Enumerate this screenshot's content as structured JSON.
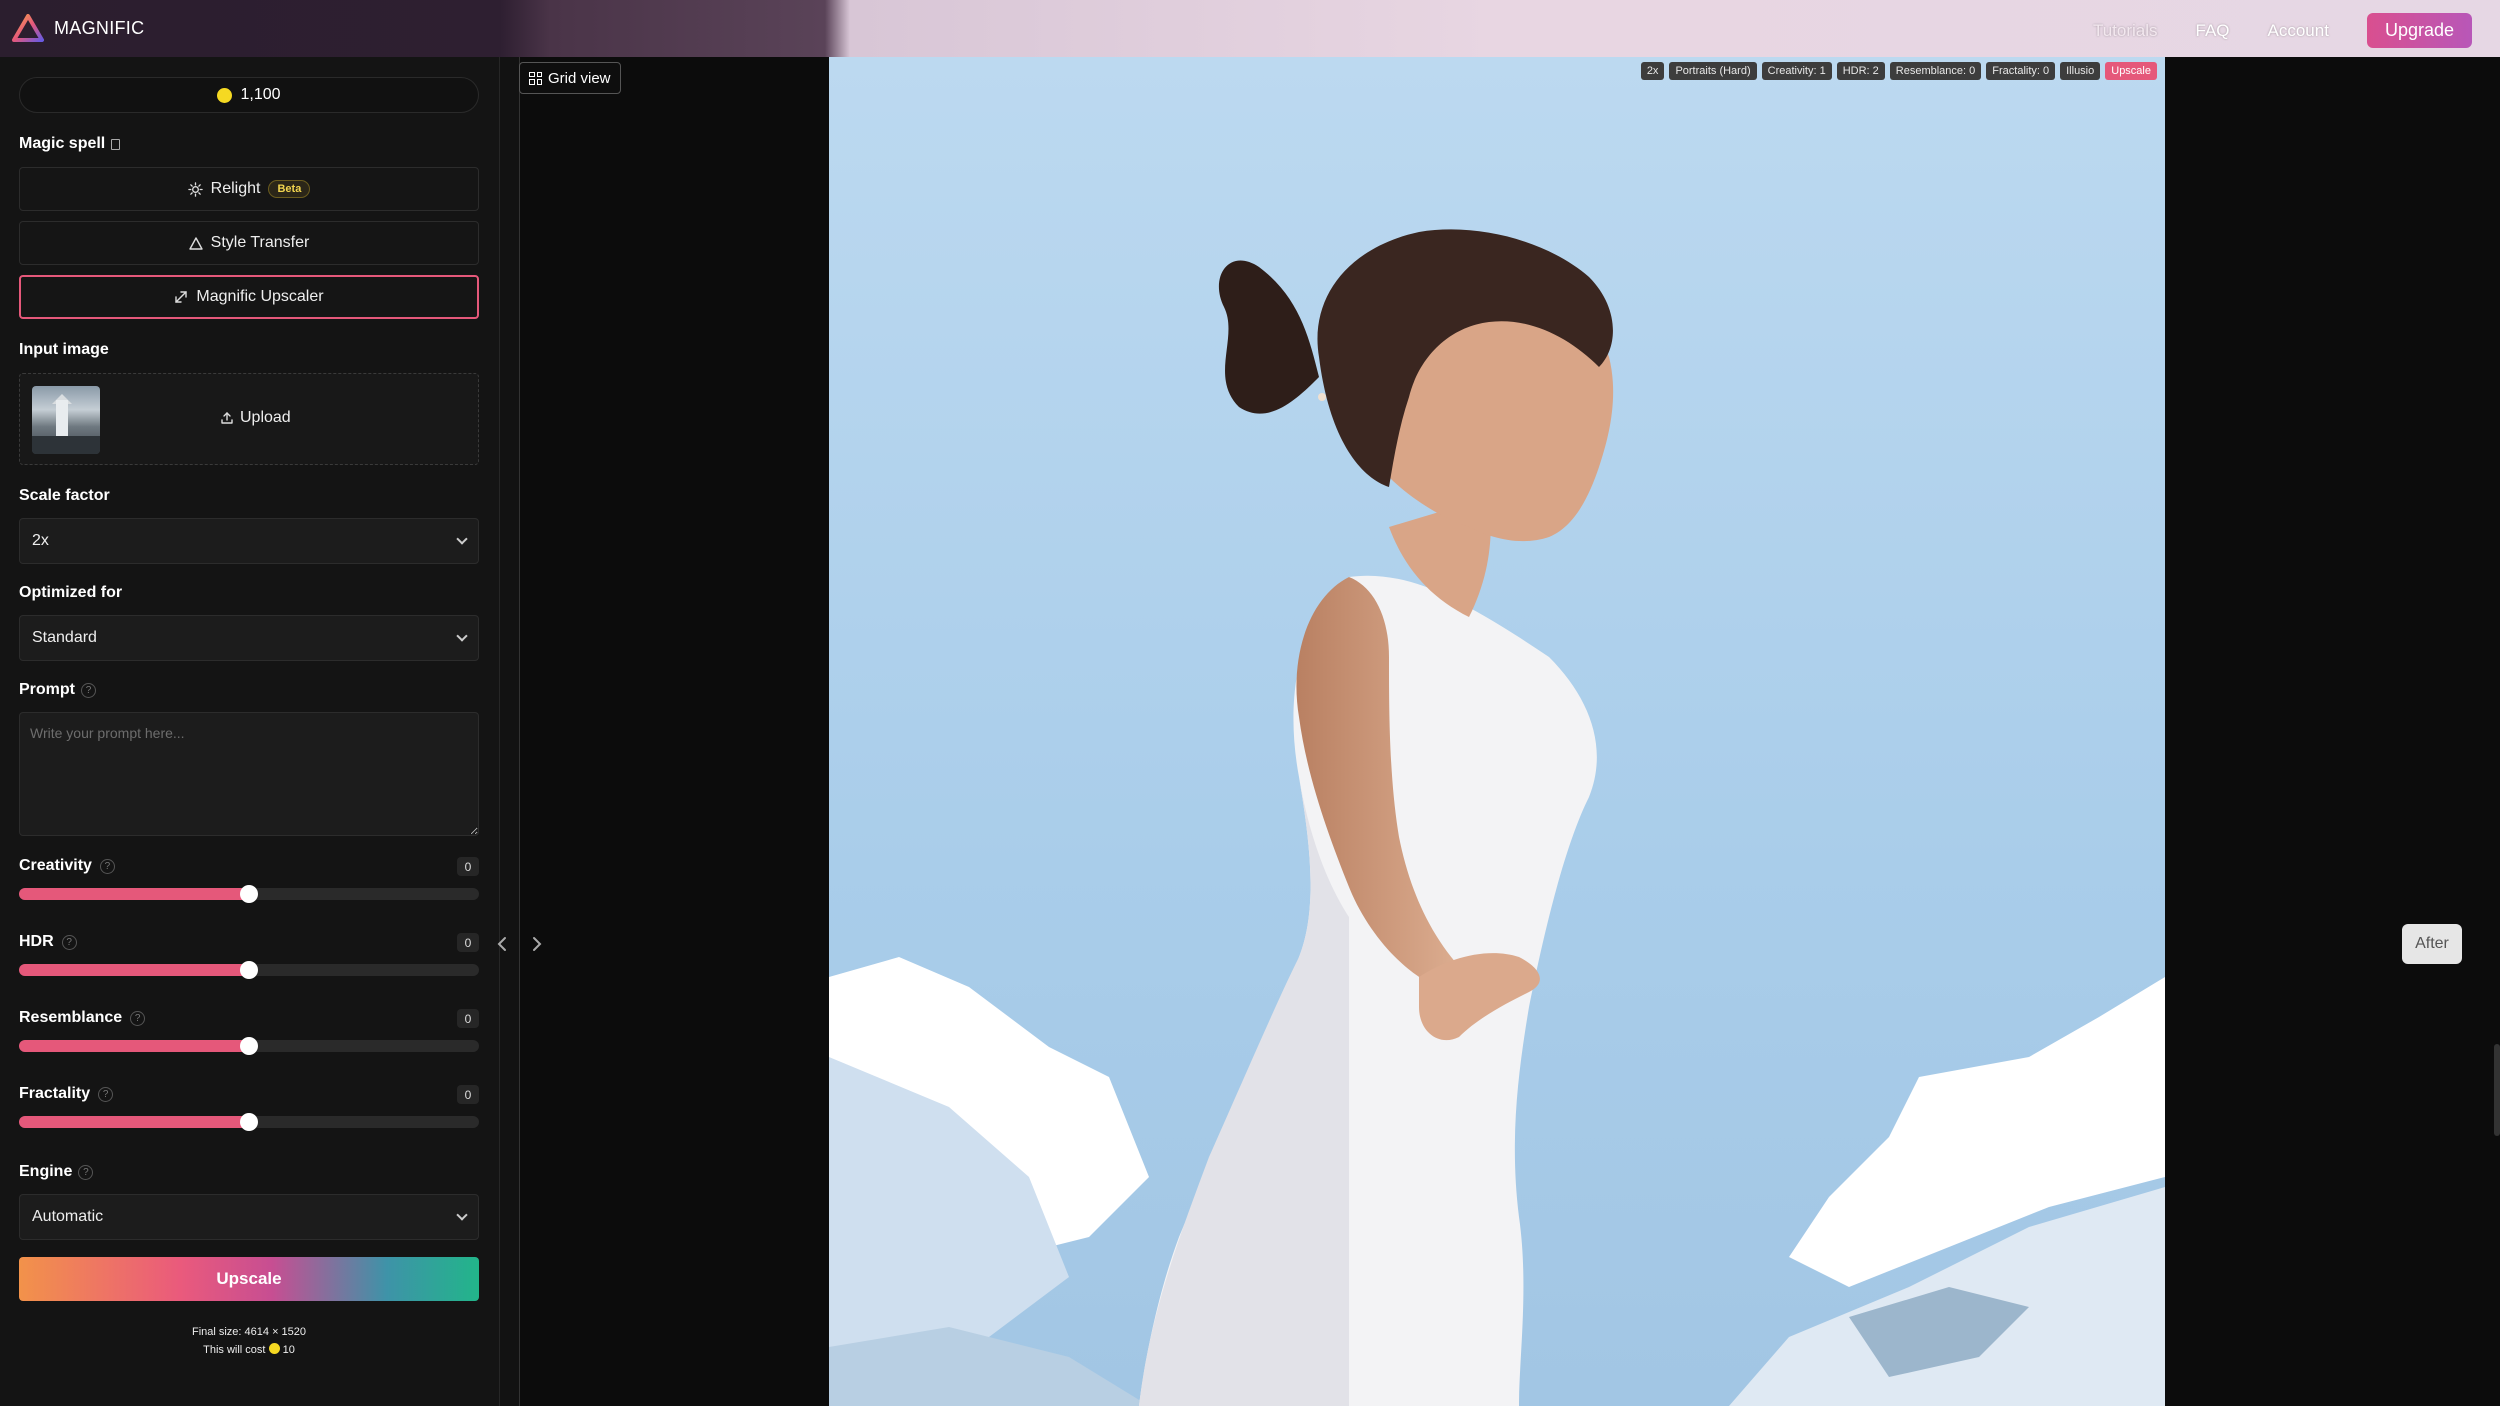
{
  "app": {
    "name": "MAGNIFIC"
  },
  "nav": {
    "tutorials": "Tutorials",
    "faq": "FAQ",
    "account": "Account",
    "upgrade": "Upgrade"
  },
  "credits": {
    "amount": "1,100"
  },
  "magic_spell": {
    "label": "Magic spell",
    "relight": "Relight",
    "relight_badge": "Beta",
    "style_transfer": "Style Transfer",
    "upscaler": "Magnific Upscaler"
  },
  "input_image": {
    "label": "Input image",
    "upload": "Upload"
  },
  "scale_factor": {
    "label": "Scale factor",
    "value": "2x"
  },
  "optimized_for": {
    "label": "Optimized for",
    "value": "Standard"
  },
  "prompt": {
    "label": "Prompt",
    "placeholder": "Write your prompt here...",
    "help": "?"
  },
  "sliders": {
    "creativity": {
      "label": "Creativity",
      "value": "0",
      "level": 0.5
    },
    "hdr": {
      "label": "HDR",
      "value": "0",
      "level": 0.5
    },
    "resemblance": {
      "label": "Resemblance",
      "value": "0",
      "level": 0.5
    },
    "fractality": {
      "label": "Fractality",
      "value": "0",
      "level": 0.5
    }
  },
  "engine": {
    "label": "Engine",
    "value": "Automatic"
  },
  "upscale_button": "Upscale",
  "final": {
    "size": "Final size: 4614 × 1520",
    "cost_prefix": "This will cost",
    "cost": "10"
  },
  "viewer": {
    "grid_view": "Grid view",
    "after": "After",
    "tags": [
      "2x",
      "Portraits (Hard)",
      "Creativity: 1",
      "HDR: 2",
      "Resemblance: 0",
      "Fractality: 0",
      "Illusio"
    ],
    "tag_action": "Upscale"
  },
  "colors": {
    "accent": "#e5587a",
    "coin": "#f5d922"
  }
}
